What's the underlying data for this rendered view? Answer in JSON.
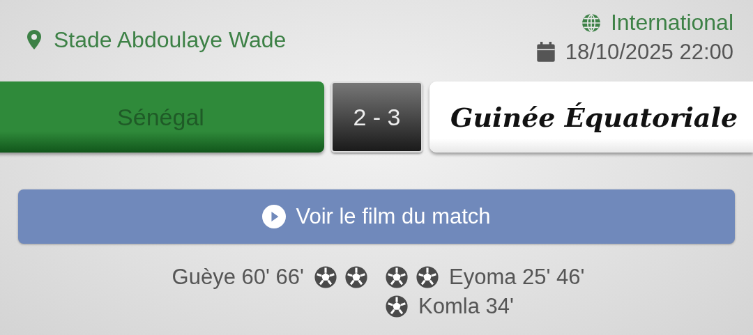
{
  "venue": "Stade Abdoulaye Wade",
  "competition": "International",
  "datetime": "18/10/2025 22:00",
  "teams": [
    {
      "name": "Sénégal",
      "color": "#2f8a3a"
    },
    {
      "name": "Guinée Équatoriale",
      "color": "#ffffff"
    }
  ],
  "score": "2 - 3",
  "video_button": "Voir le film du match",
  "scorers": {
    "home": [
      {
        "name": "Guèye",
        "minutes": [
          "60'",
          "66'"
        ]
      }
    ],
    "away": [
      {
        "name": "Eyoma",
        "minutes": [
          "25'",
          "46'"
        ]
      },
      {
        "name": "Komla",
        "minutes": [
          "34'"
        ]
      }
    ]
  }
}
